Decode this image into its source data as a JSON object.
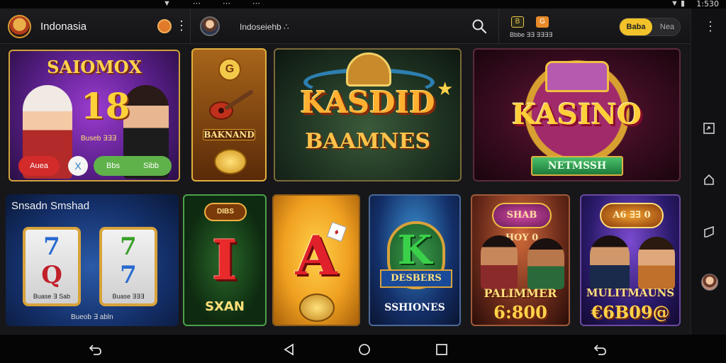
{
  "status_bar": {
    "icons": "▼ ⋯ ⋯ ⋯",
    "signal": "▼ ▮",
    "time": "1:530"
  },
  "app_bar": {
    "region": "Indonasia",
    "user_label": "Indoseiehb ∴",
    "mini_badges": {
      "badge1": "B",
      "badge2": "G",
      "label": "Bbbe ∃∃ ∃∃∃∃"
    },
    "toggle": {
      "on_label": "Baba",
      "off_label": "Nea"
    }
  },
  "tiles": {
    "t1": {
      "title": "SAIOMOX",
      "number": "18",
      "sub": "Buseb ∃∃∃",
      "btn_a": "Auea",
      "btn_x": "X",
      "btn_c1": "Bbs",
      "btn_c2": "Sibb"
    },
    "t2": {
      "icon": "G",
      "title": "BAKNAND"
    },
    "t3": {
      "title": "KASDID",
      "subtitle": "BAAMNES"
    },
    "t4": {
      "title": "KASINO",
      "ribbon": "NETMSSH"
    },
    "t5": {
      "title": "Snsadn Smshad",
      "reel1": {
        "top": "7",
        "bottom": "Q",
        "label": "Buase ∃ Sab"
      },
      "reel2": {
        "top": "7",
        "bottom": "7",
        "label": "Buase ∃∃∃"
      },
      "footer": "Bueob ∃ abln"
    },
    "t6": {
      "badge": "DIBS",
      "letter": "I",
      "title": "SXAN"
    },
    "t7": {
      "letter": "A",
      "card": "♦"
    },
    "t8": {
      "letter": "K",
      "banner": "DESBERS",
      "title": "SSHIONES"
    },
    "t9": {
      "badge": "SHAB HOY 0",
      "title": "PALIMMER",
      "amount": "6:800"
    },
    "t10": {
      "badge": "A6 ∃∃ 0",
      "title": "MULITMAUNS",
      "amount": "€6B09@"
    }
  },
  "colors": {
    "accent": "#f2c22a",
    "background": "#17171a"
  }
}
